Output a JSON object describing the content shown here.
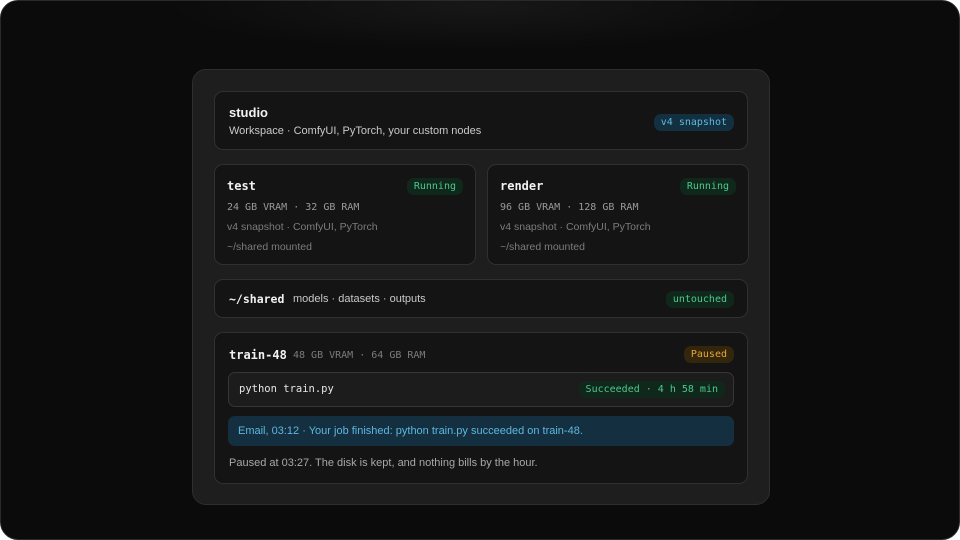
{
  "studio": {
    "name": "studio",
    "subtitle": "Workspace · ComfyUI, PyTorch, your custom nodes",
    "badge": "v4 snapshot"
  },
  "machines": [
    {
      "name": "test",
      "status": "Running",
      "specs": "24 GB VRAM · 32 GB RAM",
      "image": "v4 snapshot · ComfyUI, PyTorch",
      "mount": "~/shared mounted"
    },
    {
      "name": "render",
      "status": "Running",
      "specs": "96 GB VRAM · 128 GB RAM",
      "image": "v4 snapshot · ComfyUI, PyTorch",
      "mount": "~/shared mounted"
    }
  ],
  "shared": {
    "path": "~/shared",
    "contents": "models · datasets · outputs",
    "badge": "untouched"
  },
  "train": {
    "name": "train-48",
    "specs": "48 GB VRAM · 64 GB RAM",
    "status": "Paused",
    "job": {
      "command": "python train.py",
      "result": "Succeeded · 4 h 58 min"
    },
    "email": "Email, 03:12 · Your job finished: python train.py succeeded on train-48.",
    "footer": "Paused at 03:27. The disk is kept, and nothing bills by the hour."
  },
  "colors": {
    "background": "#0b0b0b",
    "panel": "#1e1e1e",
    "card": "#141414",
    "blue_accent": "#63b8de",
    "green_status": "#4cc78a",
    "amber_status": "#e3a63a"
  }
}
